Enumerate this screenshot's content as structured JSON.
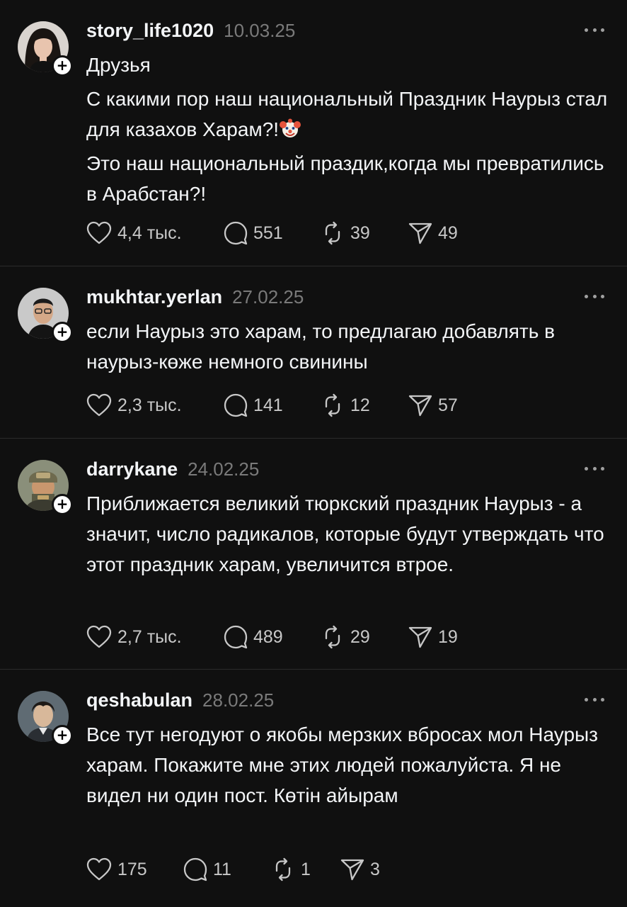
{
  "posts": [
    {
      "username": "story_life1020",
      "date": "10.03.25",
      "paragraphs": [
        "Друзья",
        "С какими пор наш национальный Праздник Наурыз стал для казахов Харам?!",
        "Это наш национальный праздик,когда мы превратились в Арабстан?!"
      ],
      "likes": "4,4 тыс.",
      "comments": "551",
      "reposts": "39",
      "shares": "49"
    },
    {
      "username": "mukhtar.yerlan",
      "date": "27.02.25",
      "paragraphs": [
        "если Наурыз это харам, то предлагаю добавлять в наурыз-көже немного свинины"
      ],
      "likes": "2,3 тыс.",
      "comments": "141",
      "reposts": "12",
      "shares": "57"
    },
    {
      "username": "darrykane",
      "date": "24.02.25",
      "paragraphs": [
        "Приближается великий тюркский праздник Наурыз - а значит, число радикалов, которые будут утверждать что этот праздник харам, увеличится втрое."
      ],
      "likes": "2,7 тыс.",
      "comments": "489",
      "reposts": "29",
      "shares": "19"
    },
    {
      "username": "qeshabulan",
      "date": "28.02.25",
      "paragraphs": [
        "Все тут негодуют о якобы мерзких вбросах мол Наурыз харам. Покажите мне этих людей пожалуйста. Я не видел ни один пост. Көтін айырам"
      ],
      "likes": "175",
      "comments": "11",
      "reposts": "1",
      "shares": "3"
    }
  ],
  "icons": {
    "follow": "plus-icon",
    "more": "more-horizontal-icon",
    "like": "heart-icon",
    "comment": "comment-bubble-icon",
    "repost": "repost-icon",
    "share": "paper-plane-icon",
    "emoji": "clown-face-emoji"
  },
  "colors": {
    "background": "#101010",
    "text": "#f3f5f7",
    "muted": "#7a7a7a",
    "action": "#c8c8c8",
    "divider": "#2b2b2b"
  }
}
